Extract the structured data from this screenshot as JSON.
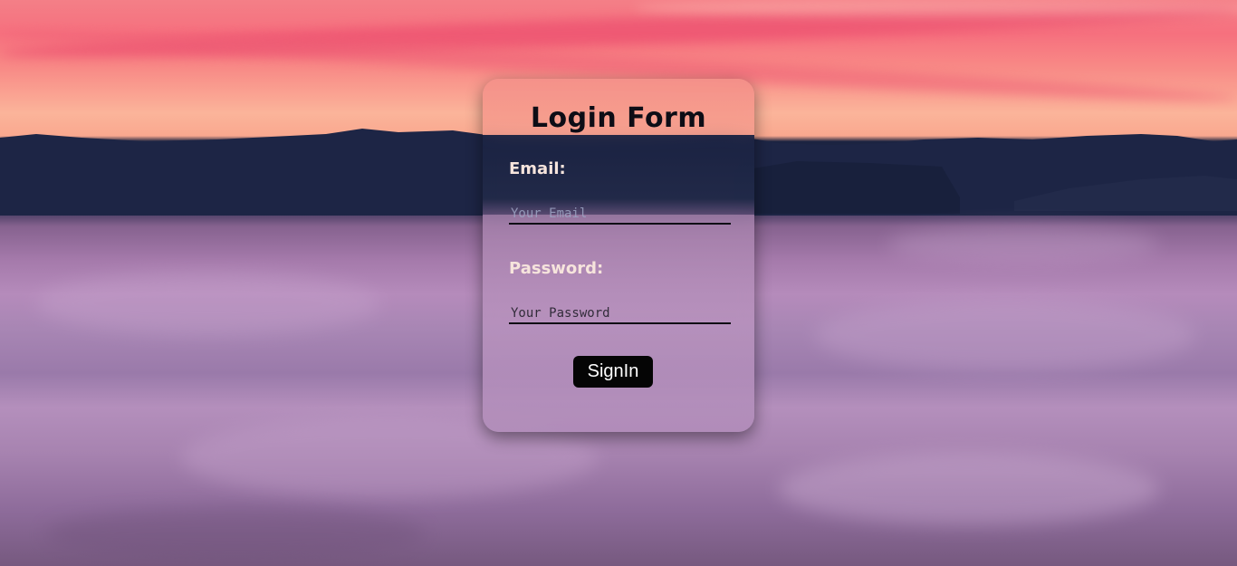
{
  "login_form": {
    "title": "Login Form",
    "email_label": "Email:",
    "email_placeholder": "Your Email",
    "email_value": "",
    "password_label": "Password:",
    "password_placeholder": "Your Password",
    "password_value": "",
    "signin_label": "SignIn"
  },
  "colors": {
    "button_bg": "#050505",
    "button_text": "#ffffff",
    "label_text": "#f6e4dc",
    "title_text": "#0d0d16"
  }
}
